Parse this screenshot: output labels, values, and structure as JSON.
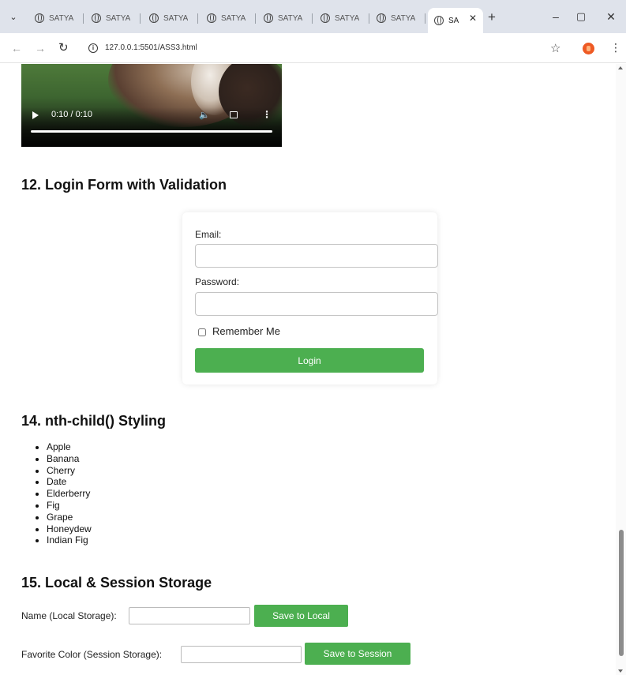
{
  "browser": {
    "tabs": [
      {
        "label": "SATYA"
      },
      {
        "label": "SATYA"
      },
      {
        "label": "SATYA"
      },
      {
        "label": "SATYA"
      },
      {
        "label": "SATYA"
      },
      {
        "label": "SATYA"
      },
      {
        "label": "SATYA"
      },
      {
        "label": "SA",
        "active": true
      }
    ],
    "url": "127.0.0.1:5501/ASS3.html"
  },
  "video": {
    "time": "0:10 / 0:10"
  },
  "login_section": {
    "heading": "12. Login Form with Validation",
    "email_label": "Email:",
    "email_value": "",
    "password_label": "Password:",
    "password_value": "",
    "remember_label": "Remember Me",
    "remember_checked": false,
    "login_button": "Login",
    "accent": "#4caf50"
  },
  "nth_section": {
    "heading": "14. nth-child() Styling",
    "items": [
      "Apple",
      "Banana",
      "Cherry",
      "Date",
      "Elderberry",
      "Fig",
      "Grape",
      "Honeydew",
      "Indian Fig"
    ]
  },
  "storage_section": {
    "heading": "15. Local & Session Storage",
    "local_label": "Name (Local Storage):",
    "local_value": "",
    "local_button": "Save to Local",
    "session_label": "Favorite Color (Session Storage):",
    "session_value": "",
    "session_button": "Save to Session"
  }
}
